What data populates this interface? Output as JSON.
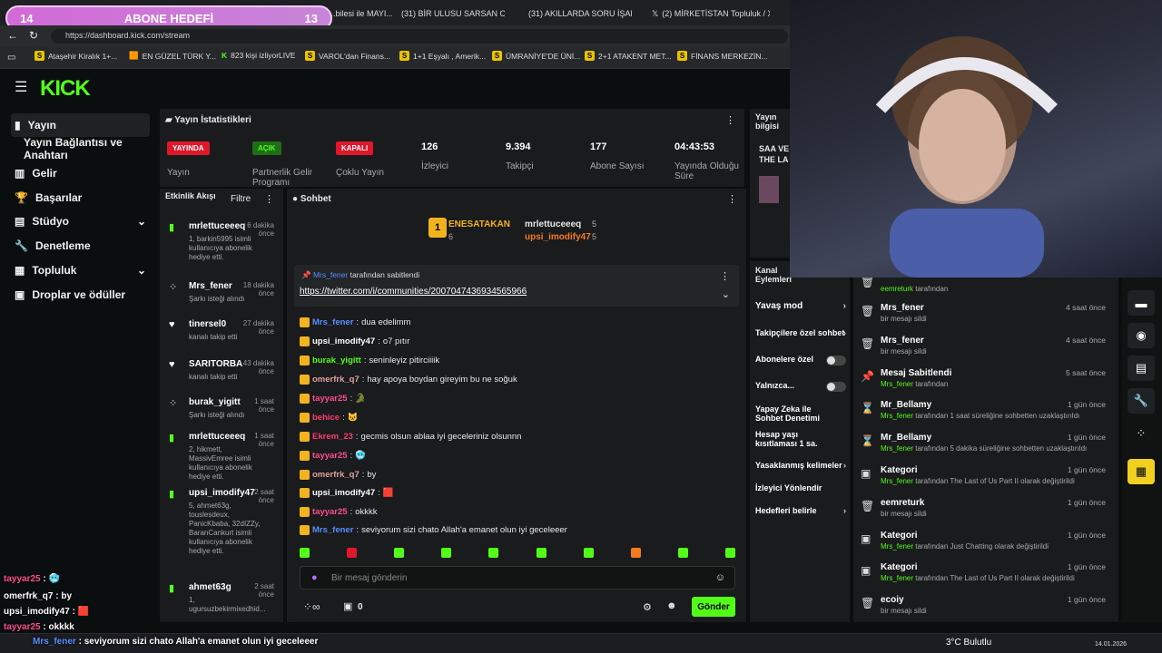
{
  "browser": {
    "tabs": [
      "...bilesi ile MAYI...",
      "(31) BİR ULUSU SARSAN OLA...",
      "(31) AKILLARDA SORU İŞARE...",
      "(2) MİRKETİSTAN Topluluk / X"
    ],
    "url": "https://dashboard.kick.com/stream",
    "bookmarks": [
      "Ataşehir Kiralık 1+...",
      "EN GÜZEL TÜRK Y...",
      "823 kişi izliyorLIVE",
      "VAROL'dan Finans...",
      "1+1 Eşyalı , Amerik...",
      "ÜMRANİYE'DE ÜNİ...",
      "2+1 ATAKENT MET...",
      "FİNANS MERKEZİN..."
    ]
  },
  "goal": {
    "left": "14",
    "title": "ABONE HEDEFİ",
    "right": "13"
  },
  "sidebar": {
    "items": [
      "Yayın",
      "Yayın Bağlantısı ve Anahtarı",
      "Gelir",
      "Başarılar",
      "Stüdyo",
      "Denetleme",
      "Topluluk",
      "Droplar ve ödüller"
    ]
  },
  "stats": {
    "title": "Yayın İstatistikleri",
    "items": [
      {
        "badge": "YAYINDA",
        "label": "Yayın",
        "color": "#e0162b"
      },
      {
        "badge": "AÇIK",
        "label": "Partnerlik Gelir Programı",
        "color": "#1f6e17"
      },
      {
        "badge": "KAPALI",
        "label": "Çoklu Yayın",
        "color": "#e0162b"
      },
      {
        "value": "126",
        "label": "İzleyici"
      },
      {
        "value": "9.394",
        "label": "Takipçi"
      },
      {
        "value": "177",
        "label": "Abone Sayısı"
      },
      {
        "value": "04:43:53",
        "label": "Yayında Olduğu Süre"
      }
    ]
  },
  "streaminfo": {
    "title": "Yayın bilgisi",
    "text": "SAA VE THE LA",
    "s": "S"
  },
  "activity": {
    "title": "Etkinlik Akışı",
    "filter": "Filtre",
    "items": [
      {
        "name": "mrlettuceeeq",
        "time": "6 dakika önce",
        "desc": "1, barkin5995 isimli kullanıcıya abonelik hediye etti."
      },
      {
        "name": "Mrs_fener",
        "time": "18 dakika önce",
        "desc": "Şarkı isteği alındı"
      },
      {
        "name": "tinersel0",
        "time": "27 dakika önce",
        "desc": "kanalı takip etti"
      },
      {
        "name": "SARITORBA",
        "time": "43 dakika önce",
        "desc": "kanalı takip etti"
      },
      {
        "name": "burak_yigitt",
        "time": "1 saat önce",
        "desc": "Şarkı isteği alındı"
      },
      {
        "name": "mrlettuceeeq",
        "time": "1 saat önce",
        "desc": "2, hikmett, MassivEmree isimli kullanıcıya abonelik hediye etti."
      },
      {
        "name": "upsi_imodify47",
        "time": "2 saat önce",
        "desc": "5, ahmet63g, touslesdeux, PanicKbaba, 32dIZZy, BaranCankurt isimli kullanıcıya abonelik hediye etti."
      },
      {
        "name": "ahmet63g",
        "time": "2 saat önce",
        "desc": "1, ugursuzbekirmixedhid..."
      }
    ]
  },
  "chat": {
    "title": "Sohbet",
    "top": {
      "first": "ENESATAKAN",
      "first_count": "6",
      "second": "mrlettuceeeq",
      "second_count": "5",
      "third": "upsi_imodify47",
      "third_count": "5"
    },
    "pinned_by": "Mrs_fener",
    "pinned_suffix": "tarafından sabitlendi",
    "pinned_link": "https://twitter.com/i/communities/2007047436934565966",
    "messages": [
      {
        "user": "Mrs_fener",
        "color": "#5b8dff",
        "text": "dua edelimm"
      },
      {
        "user": "upsi_imodify47",
        "color": "#ffffff",
        "text": "o7 pıtır"
      },
      {
        "user": "burak_yigitt",
        "color": "#53fc18",
        "text": "seninleyiz pitirciiiik"
      },
      {
        "user": "omerfrk_q7",
        "color": "#e0a0a0",
        "text": "hay apoya boydan gireyim bu ne soğuk"
      },
      {
        "user": "tayyar25",
        "color": "#ff4e8a",
        "text": "🐊"
      },
      {
        "user": "behice",
        "color": "#ff3c6e",
        "text": "🐱"
      },
      {
        "user": "Ekrem_23",
        "color": "#ff3c6e",
        "text": "gecmis olsun ablaa iyi geceleriniz olsunnn"
      },
      {
        "user": "tayyar25",
        "color": "#ff4e8a",
        "text": "🥶"
      },
      {
        "user": "omerfrk_q7",
        "color": "#e0a0a0",
        "text": "by"
      },
      {
        "user": "upsi_imodify47",
        "color": "#ffffff",
        "text": "🟥"
      },
      {
        "user": "tayyar25",
        "color": "#ff4e8a",
        "text": "okkkk"
      },
      {
        "user": "Mrs_fener",
        "color": "#5b8dff",
        "text": "seviyorum sizi chato Allah'a emanet olun iyi geceleeer"
      }
    ],
    "input_placeholder": "Bir mesaj gönderin",
    "counter": "0",
    "send": "Gönder"
  },
  "actions": {
    "title": "Kanal Eylemleri",
    "items": [
      "Yavaş mod",
      "Takipçilere özel sohbet",
      "Abonelere özel",
      "Yalnızca...",
      "Yapay Zeka ile Sohbet Denetimi",
      "Hesap yaşı kısıtlaması 1 sa.",
      "Yasaklanmış kelimeler",
      "İzleyici Yönlendir",
      "Hedefleri belirle"
    ]
  },
  "modlog": [
    {
      "title": "eemreturk",
      "desc": "tarafından",
      "time": "",
      "icon": "trash-icon"
    },
    {
      "title": "Mrs_fener",
      "desc": "bir mesajı sildi",
      "time": "4 saat önce",
      "icon": "trash-icon"
    },
    {
      "title": "Mrs_fener",
      "desc": "bir mesajı sildi",
      "time": "4 saat önce",
      "icon": "trash-icon"
    },
    {
      "title": "Mesaj Sabitlendi",
      "desc": "Mrs_fener tarafından",
      "time": "5 saat önce",
      "icon": "pin-icon"
    },
    {
      "title": "Mr_Bellamy",
      "desc": "Mrs_fener tarafından 1 saat süreliğine sohbetten uzaklaştırıldı",
      "time": "1 gün önce",
      "icon": "hourglass-icon"
    },
    {
      "title": "Mr_Bellamy",
      "desc": "Mrs_fener tarafından 5 dakika süreliğine sohbetten uzaklaştırıldı",
      "time": "1 gün önce",
      "icon": "hourglass-icon"
    },
    {
      "title": "Kategori",
      "desc": "Mrs_fener tarafından The Last of Us Part II olarak değiştirildi",
      "time": "1 gün önce",
      "icon": "category-icon"
    },
    {
      "title": "eemreturk",
      "desc": "bir mesajı sildi",
      "time": "1 gün önce",
      "icon": "trash-icon"
    },
    {
      "title": "Kategori",
      "desc": "Mrs_fener tarafından Just Chatting olarak değiştirildi",
      "time": "1 gün önce",
      "icon": "category-icon"
    },
    {
      "title": "Kategori",
      "desc": "Mrs_fener tarafından The Last of Us Part II olarak değiştirildi",
      "time": "1 gün önce",
      "icon": "category-icon"
    },
    {
      "title": "ecoiy",
      "desc": "bir mesajı sildi",
      "time": "1 gün önce",
      "icon": "trash-icon"
    }
  ],
  "overlay": [
    {
      "user": "tayyar25",
      "text": "🥶"
    },
    {
      "user": "omerfrk_q7",
      "text": "by"
    },
    {
      "user": "upsi_imodify47",
      "text": "🟥"
    },
    {
      "user": "tayyar25",
      "text": "okkkk"
    }
  ],
  "bottom_overlay": {
    "user": "Mrs_fener",
    "text": "seviyorum sizi chato Allah'a emanet olun iyi geceleeer"
  },
  "taskbar": {
    "weather": "3°C Bulutlu",
    "date": "14.01.2026"
  }
}
